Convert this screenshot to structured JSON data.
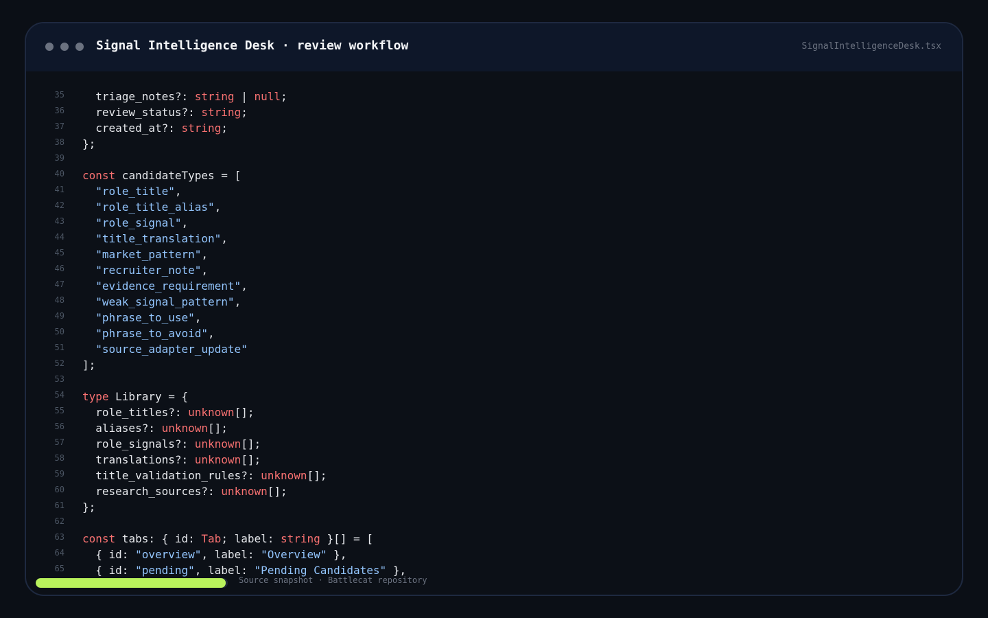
{
  "window": {
    "title": "Signal Intelligence Desk · review workflow",
    "filename": "SignalIntelligenceDesk.tsx"
  },
  "code": {
    "lines": [
      {
        "n": "35",
        "tokens": [
          [
            "  triage_notes?: ",
            "pu"
          ],
          [
            "string",
            "kw"
          ],
          [
            " | ",
            "pu"
          ],
          [
            "null",
            "kw"
          ],
          [
            ";",
            "pu"
          ]
        ]
      },
      {
        "n": "36",
        "tokens": [
          [
            "  review_status?: ",
            "pu"
          ],
          [
            "string",
            "kw"
          ],
          [
            ";",
            "pu"
          ]
        ]
      },
      {
        "n": "37",
        "tokens": [
          [
            "  created_at?: ",
            "pu"
          ],
          [
            "string",
            "kw"
          ],
          [
            ";",
            "pu"
          ]
        ]
      },
      {
        "n": "38",
        "tokens": [
          [
            "};",
            "pu"
          ]
        ]
      },
      {
        "n": "39",
        "tokens": []
      },
      {
        "n": "40",
        "tokens": [
          [
            "const",
            "kw"
          ],
          [
            " candidateTypes = [",
            "pu"
          ]
        ]
      },
      {
        "n": "41",
        "tokens": [
          [
            "  ",
            "pu"
          ],
          [
            "\"role_title\"",
            "st"
          ],
          [
            ",",
            "pu"
          ]
        ]
      },
      {
        "n": "42",
        "tokens": [
          [
            "  ",
            "pu"
          ],
          [
            "\"role_title_alias\"",
            "st"
          ],
          [
            ",",
            "pu"
          ]
        ]
      },
      {
        "n": "43",
        "tokens": [
          [
            "  ",
            "pu"
          ],
          [
            "\"role_signal\"",
            "st"
          ],
          [
            ",",
            "pu"
          ]
        ]
      },
      {
        "n": "44",
        "tokens": [
          [
            "  ",
            "pu"
          ],
          [
            "\"title_translation\"",
            "st"
          ],
          [
            ",",
            "pu"
          ]
        ]
      },
      {
        "n": "45",
        "tokens": [
          [
            "  ",
            "pu"
          ],
          [
            "\"market_pattern\"",
            "st"
          ],
          [
            ",",
            "pu"
          ]
        ]
      },
      {
        "n": "46",
        "tokens": [
          [
            "  ",
            "pu"
          ],
          [
            "\"recruiter_note\"",
            "st"
          ],
          [
            ",",
            "pu"
          ]
        ]
      },
      {
        "n": "47",
        "tokens": [
          [
            "  ",
            "pu"
          ],
          [
            "\"evidence_requirement\"",
            "st"
          ],
          [
            ",",
            "pu"
          ]
        ]
      },
      {
        "n": "48",
        "tokens": [
          [
            "  ",
            "pu"
          ],
          [
            "\"weak_signal_pattern\"",
            "st"
          ],
          [
            ",",
            "pu"
          ]
        ]
      },
      {
        "n": "49",
        "tokens": [
          [
            "  ",
            "pu"
          ],
          [
            "\"phrase_to_use\"",
            "st"
          ],
          [
            ",",
            "pu"
          ]
        ]
      },
      {
        "n": "50",
        "tokens": [
          [
            "  ",
            "pu"
          ],
          [
            "\"phrase_to_avoid\"",
            "st"
          ],
          [
            ",",
            "pu"
          ]
        ]
      },
      {
        "n": "51",
        "tokens": [
          [
            "  ",
            "pu"
          ],
          [
            "\"source_adapter_update\"",
            "st"
          ]
        ]
      },
      {
        "n": "52",
        "tokens": [
          [
            "];",
            "pu"
          ]
        ]
      },
      {
        "n": "53",
        "tokens": []
      },
      {
        "n": "54",
        "tokens": [
          [
            "type",
            "kw"
          ],
          [
            " Library = {",
            "pu"
          ]
        ]
      },
      {
        "n": "55",
        "tokens": [
          [
            "  role_titles?: ",
            "pu"
          ],
          [
            "unknown",
            "kw"
          ],
          [
            "[];",
            "pu"
          ]
        ]
      },
      {
        "n": "56",
        "tokens": [
          [
            "  aliases?: ",
            "pu"
          ],
          [
            "unknown",
            "kw"
          ],
          [
            "[];",
            "pu"
          ]
        ]
      },
      {
        "n": "57",
        "tokens": [
          [
            "  role_signals?: ",
            "pu"
          ],
          [
            "unknown",
            "kw"
          ],
          [
            "[];",
            "pu"
          ]
        ]
      },
      {
        "n": "58",
        "tokens": [
          [
            "  translations?: ",
            "pu"
          ],
          [
            "unknown",
            "kw"
          ],
          [
            "[];",
            "pu"
          ]
        ]
      },
      {
        "n": "59",
        "tokens": [
          [
            "  title_validation_rules?: ",
            "pu"
          ],
          [
            "unknown",
            "kw"
          ],
          [
            "[];",
            "pu"
          ]
        ]
      },
      {
        "n": "60",
        "tokens": [
          [
            "  research_sources?: ",
            "pu"
          ],
          [
            "unknown",
            "kw"
          ],
          [
            "[];",
            "pu"
          ]
        ]
      },
      {
        "n": "61",
        "tokens": [
          [
            "};",
            "pu"
          ]
        ]
      },
      {
        "n": "62",
        "tokens": []
      },
      {
        "n": "63",
        "tokens": [
          [
            "const",
            "kw"
          ],
          [
            " tabs: { id: ",
            "pu"
          ],
          [
            "Tab",
            "kw"
          ],
          [
            "; label: ",
            "pu"
          ],
          [
            "string",
            "kw"
          ],
          [
            " }[] = [",
            "pu"
          ]
        ]
      },
      {
        "n": "64",
        "tokens": [
          [
            "  { id: ",
            "pu"
          ],
          [
            "\"overview\"",
            "st"
          ],
          [
            ", label: ",
            "pu"
          ],
          [
            "\"Overview\"",
            "st"
          ],
          [
            " },",
            "pu"
          ]
        ]
      },
      {
        "n": "65",
        "tokens": [
          [
            "  { id: ",
            "pu"
          ],
          [
            "\"pending\"",
            "st"
          ],
          [
            ", label: ",
            "pu"
          ],
          [
            "\"Pending Candidates\"",
            "st"
          ],
          [
            " },",
            "pu"
          ]
        ]
      }
    ]
  },
  "footer": {
    "caption": "Source snapshot · Battlecat repository",
    "progress_fraction": 0.22
  },
  "colors": {
    "keyword": "#f87171",
    "string": "#93c5fd",
    "progress": "#b9f25c"
  }
}
